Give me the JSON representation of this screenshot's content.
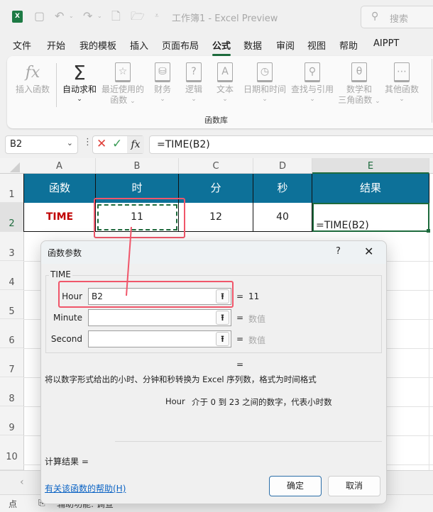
{
  "titlebar": {
    "title": "工作簿1  -  Excel Preview",
    "search_placeholder": "搜索",
    "icons": [
      "excel-logo",
      "save",
      "undo",
      "redo",
      "new-file",
      "open-folder",
      "customize"
    ]
  },
  "menu": {
    "items": [
      "文件",
      "开始",
      "我的模板",
      "插入",
      "页面布局",
      "公式",
      "数据",
      "审阅",
      "视图",
      "帮助",
      "AIPPT"
    ],
    "active": "公式"
  },
  "ribbon": {
    "group_label": "函数库",
    "buttons": [
      {
        "label": "插入函数",
        "icon": "fx"
      },
      {
        "label": "自动求和",
        "icon": "Σ",
        "enabled": true
      },
      {
        "label": "最近使用的\n函数",
        "icon": "☆"
      },
      {
        "label": "财务",
        "icon": "db"
      },
      {
        "label": "逻辑",
        "icon": "?"
      },
      {
        "label": "文本",
        "icon": "A"
      },
      {
        "label": "日期和时间",
        "icon": "clock"
      },
      {
        "label": "查找与引用",
        "icon": "search"
      },
      {
        "label": "数学和\n三角函数",
        "icon": "θ"
      },
      {
        "label": "其他函数",
        "icon": "..."
      }
    ],
    "b0": "插入函数",
    "b1": "自动求和",
    "b2a": "最近使用的",
    "b2b": "函数",
    "b3": "财务",
    "b4": "逻辑",
    "b5": "文本",
    "b6": "日期和时间",
    "b7": "查找与引用",
    "b8a": "数学和",
    "b8b": "三角函数",
    "b9": "其他函数"
  },
  "formula_bar": {
    "name_box": "B2",
    "formula": "=TIME(B2)"
  },
  "sheet": {
    "columns": [
      "A",
      "B",
      "C",
      "D",
      "E"
    ],
    "selected_column": "E",
    "rows": [
      "1",
      "2",
      "3",
      "4",
      "5",
      "6",
      "7",
      "8",
      "9",
      "10"
    ],
    "header": [
      "函数",
      "时",
      "分",
      "秒",
      "结果"
    ],
    "row2": [
      "TIME",
      "11",
      "12",
      "40",
      "=TIME(B2)"
    ],
    "header_color": "#0d7199",
    "function_name_color": "#c00000"
  },
  "dialog": {
    "title": "函数参数",
    "help": "?",
    "close": "✕",
    "function_name": "TIME",
    "args": [
      {
        "label": "Hour",
        "value": "B2",
        "result": "11"
      },
      {
        "label": "Minute",
        "value": "",
        "result": "数值"
      },
      {
        "label": "Second",
        "value": "",
        "result": "数值"
      }
    ],
    "total_eq": "=",
    "description": "将以数字形式给出的小时、分钟和秒转换为 Excel 序列数，格式为时间格式",
    "arg_desc_name": "Hour",
    "arg_desc": "介于 0 到 23 之间的数字，代表小时数",
    "calc_result": "计算结果 =",
    "help_link": "有关该函数的帮助(H)",
    "ok": "确定",
    "cancel": "取消",
    "eq": "="
  },
  "status": {
    "left": "点",
    "accessibility": "辅助功能: 调查"
  }
}
